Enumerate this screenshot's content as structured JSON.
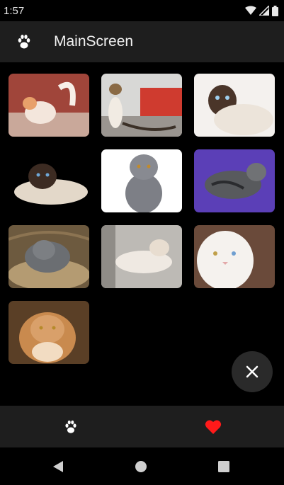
{
  "status_bar": {
    "time": "1:57"
  },
  "app_bar": {
    "title": "MainScreen",
    "icon": "paw-icon"
  },
  "grid": {
    "tiles": [
      {
        "name": "cat-photo-1"
      },
      {
        "name": "cat-photo-2"
      },
      {
        "name": "cat-photo-3"
      },
      {
        "name": "cat-photo-4"
      },
      {
        "name": "cat-photo-5"
      },
      {
        "name": "cat-photo-6"
      },
      {
        "name": "cat-photo-7"
      },
      {
        "name": "cat-photo-8"
      },
      {
        "name": "cat-photo-9"
      },
      {
        "name": "cat-photo-10"
      }
    ]
  },
  "fab": {
    "icon": "close-icon"
  },
  "bottom_nav": {
    "items": [
      {
        "icon": "paw-icon",
        "color": "#ffffff"
      },
      {
        "icon": "heart-icon",
        "color": "#ff1a1a"
      }
    ]
  },
  "system_nav": {
    "items": [
      "back-icon",
      "home-icon",
      "recents-icon"
    ]
  }
}
